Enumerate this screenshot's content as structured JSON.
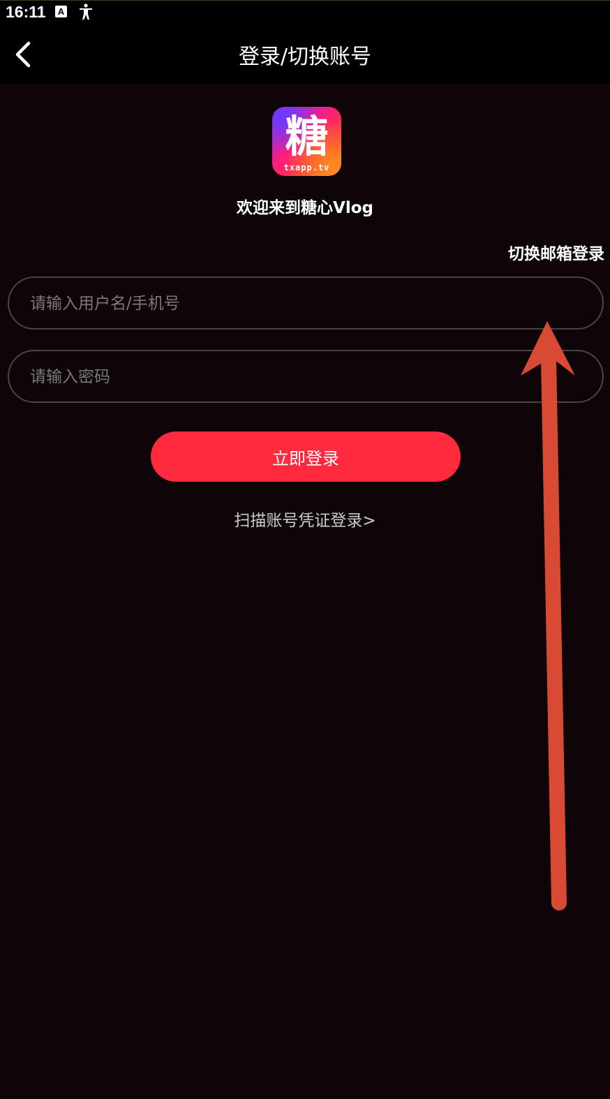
{
  "status_bar": {
    "time": "16:11",
    "icons": [
      "a-font-icon",
      "accessibility-icon"
    ],
    "icon_a_letter": "A"
  },
  "header": {
    "back_icon": "chevron-left-icon",
    "title": "登录/切换账号"
  },
  "logo": {
    "glyph": "糖",
    "domain": "txapp.tv"
  },
  "welcome": "欢迎来到糖心Vlog",
  "switch_email_label": "切换邮箱登录",
  "form": {
    "username_placeholder": "请输入用户名/手机号",
    "username_value": "",
    "password_placeholder": "请输入密码",
    "password_value": "",
    "login_label": "立即登录"
  },
  "scan_login_label": "扫描账号凭证登录>",
  "colors": {
    "background": "#0e0508",
    "bar": "#000000",
    "accent": "#ff2a3d",
    "input_border": "#4a4448",
    "placeholder": "#7d777a",
    "annotation_arrow": "#d94a35"
  }
}
